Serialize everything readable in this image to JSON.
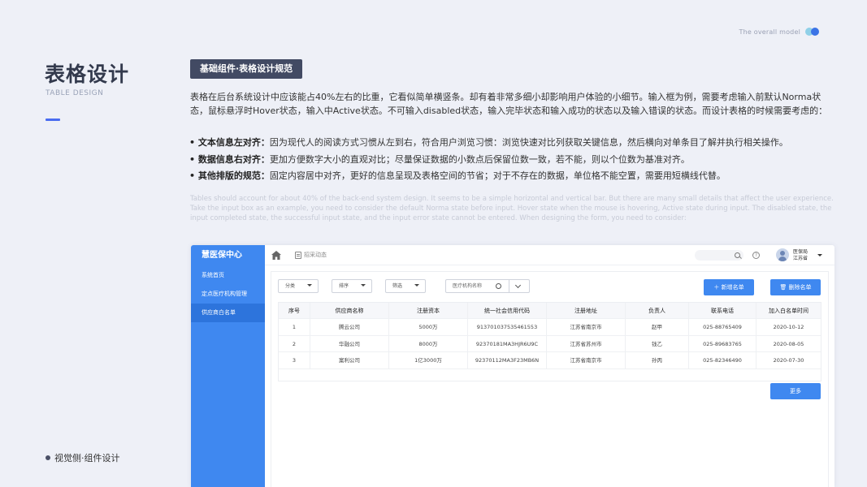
{
  "header": {
    "tagline": "The overall model"
  },
  "title": {
    "main": "表格设计",
    "sub": "TABLE DESIGN"
  },
  "footer": {
    "label": "视觉侧·组件设计"
  },
  "section": {
    "tag": "基础组件·表格设计规范",
    "paragraph": "表格在后台系统设计中应该能占40%左右的比重，它看似简单横竖条。却有着非常多细小却影响用户体验的小细节。输入框为例，需要考虑输入前默认Norma状态，鼠标悬浮时Hover状态，输入中Active状态。不可输入disabled状态，输入完毕状态和输入成功的状态以及输入错误的状态。而设计表格的时候需要考虑的：",
    "bullets": [
      {
        "title": "• 文本信息左对齐：",
        "text": "因为现代人的阅读方式习惯从左到右，符合用户浏览习惯：浏览快速对比列获取关键信息，然后横向对单条目了解并执行相关操作。"
      },
      {
        "title": "• 数据信息右对齐：",
        "text": "更加方便数字大小的直观对比；尽量保证数据的小数点后保留位数一致，若不能，则以个位数为基准对齐。"
      },
      {
        "title": "• 其他排版的规范：",
        "text": "固定内容居中对齐，更好的信息呈现及表格空间的节省；对于不存在的数据，单位格不能空置，需要用短横线代替。"
      }
    ],
    "english": "Tables should account for about 40% of the back-end system design. It seems to be a simple horizontal and vertical bar. But there are many small details that affect the user experience. Take the input box as an example, you need to consider the default Norma state before input.  Hover state when the mouse is hovering, Active state during input. The disabled state, the input completed state, the successful input state, and the input error state cannot be entered. When designing the form, you need to consider:"
  },
  "app": {
    "brand": "慧医保中心",
    "sidebar": [
      {
        "label": "系统首页",
        "active": false
      },
      {
        "label": "定点医疗机构管理",
        "active": false
      },
      {
        "label": "供应商白名单",
        "active": true
      }
    ],
    "breadcrumb": "招采动态",
    "user": {
      "name": "医保局",
      "region": "江苏省"
    },
    "filters": {
      "category": "分类",
      "sort": "排序",
      "filter": "筛选",
      "search_placeholder": "医疗机构名称"
    },
    "buttons": {
      "add": "新增名单",
      "delete": "删除名单",
      "more": "更多"
    },
    "table": {
      "columns": [
        "序号",
        "供应商名称",
        "注册资本",
        "统一社会信用代码",
        "注册地址",
        "负责人",
        "联系电话",
        "加入白名单时间"
      ],
      "rows": [
        [
          "1",
          "腾云公司",
          "5000万",
          "91370103753546​1553",
          "江苏省南京市",
          "赵甲",
          "025-88765409",
          "2020-10-12"
        ],
        [
          "2",
          "华融公司",
          "8000万",
          "92370181MA3HJR6U9C",
          "江苏省苏州市",
          "钱乙",
          "025-89683765",
          "2020-08-05"
        ],
        [
          "3",
          "案利公司",
          "1亿3000万",
          "92370112MA3F23MB6N",
          "江苏省南京市",
          "孙丙",
          "025-82346490",
          "2020-07-30"
        ]
      ]
    }
  },
  "colors": {
    "accent": "#3f88f0",
    "tag_bg": "#424a63",
    "title_bar": "#4a6cf0"
  }
}
